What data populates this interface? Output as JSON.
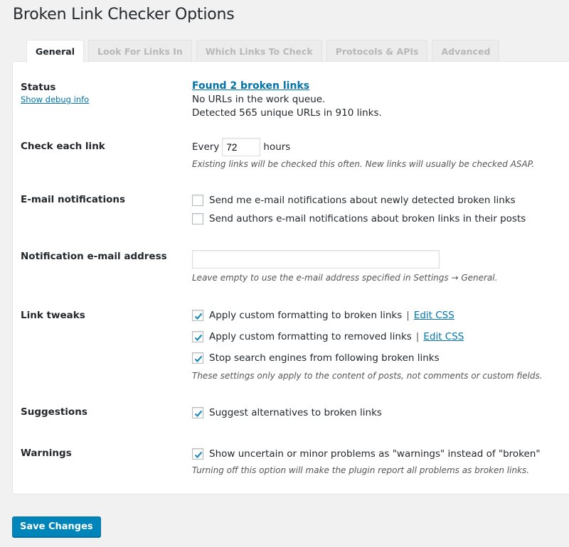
{
  "page": {
    "title": "Broken Link Checker Options"
  },
  "tabs": [
    {
      "label": "General",
      "active": true
    },
    {
      "label": "Look For Links In",
      "active": false
    },
    {
      "label": "Which Links To Check",
      "active": false
    },
    {
      "label": "Protocols & APIs",
      "active": false
    },
    {
      "label": "Advanced",
      "active": false
    }
  ],
  "status": {
    "label": "Status",
    "debug_link": "Show debug info",
    "broken_link_text": "Found 2 broken links",
    "queue_text": "No URLs in the work queue.",
    "detected_text": "Detected 565 unique URLs in 910 links."
  },
  "check_interval": {
    "label": "Check each link",
    "prefix": "Every",
    "value": "72",
    "suffix": "hours",
    "description": "Existing links will be checked this often. New links will usually be checked ASAP."
  },
  "email_notifications": {
    "label": "E-mail notifications",
    "options": [
      {
        "label": "Send me e-mail notifications about newly detected broken links",
        "checked": false
      },
      {
        "label": "Send authors e-mail notifications about broken links in their posts",
        "checked": false
      }
    ]
  },
  "notification_email": {
    "label": "Notification e-mail address",
    "value": "",
    "placeholder": "",
    "description": "Leave empty to use the e-mail address specified in Settings → General."
  },
  "link_tweaks": {
    "label": "Link tweaks",
    "options": [
      {
        "label": "Apply custom formatting to broken links",
        "checked": true,
        "separator": "|",
        "link": "Edit CSS"
      },
      {
        "label": "Apply custom formatting to removed links",
        "checked": true,
        "separator": "|",
        "link": "Edit CSS"
      },
      {
        "label": "Stop search engines from following broken links",
        "checked": true
      }
    ],
    "description": "These settings only apply to the content of posts, not comments or custom fields."
  },
  "suggestions": {
    "label": "Suggestions",
    "option": {
      "label": "Suggest alternatives to broken links",
      "checked": true
    }
  },
  "warnings": {
    "label": "Warnings",
    "option": {
      "label": "Show uncertain or minor problems as \"warnings\" instead of \"broken\"",
      "checked": true
    },
    "description": "Turning off this option will make the plugin report all problems as broken links."
  },
  "footer": {
    "save_label": "Save Changes"
  },
  "colors": {
    "accent": "#0073aa",
    "button": "#0085ba",
    "check": "#1e8cbe",
    "background": "#f1f1f1"
  }
}
